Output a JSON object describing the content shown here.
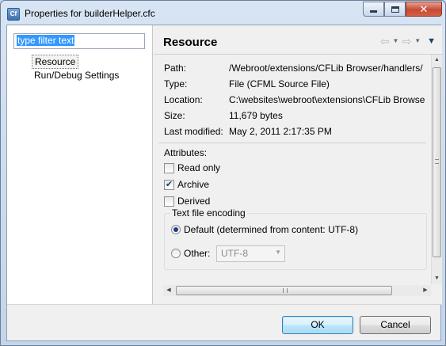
{
  "window": {
    "title": "Properties for builderHelper.cfc",
    "app_icon_text": "Cf",
    "close_glyph": "✕"
  },
  "left": {
    "filter_value": "type filter text",
    "tree_items": [
      {
        "label": "Resource",
        "selected": true
      },
      {
        "label": "Run/Debug Settings",
        "selected": false
      }
    ]
  },
  "right": {
    "title": "Resource",
    "icons": [
      "back-arrow-icon",
      "dropdown-icon",
      "forward-arrow-icon",
      "dropdown-icon",
      "view-menu-icon"
    ],
    "properties": [
      {
        "label": "Path:",
        "value": "/Webroot/extensions/CFLib Browser/handlers/"
      },
      {
        "label": "Type:",
        "value": "File  (CFML Source File)"
      },
      {
        "label": "Location:",
        "value": "C:\\websites\\webroot\\extensions\\CFLib Browse"
      },
      {
        "label": "Size:",
        "value": "11,679  bytes"
      },
      {
        "label": "Last modified:",
        "value": "May 2, 2011 2:17:35 PM"
      }
    ],
    "attributes_title": "Attributes:",
    "attributes": [
      {
        "label": "Read only",
        "checked": false
      },
      {
        "label": "Archive",
        "checked": true
      },
      {
        "label": "Derived",
        "checked": false
      }
    ],
    "encoding": {
      "title": "Text file encoding",
      "default_label": "Default (determined from content: UTF-8)",
      "default_selected": true,
      "other_label": "Other:",
      "other_selected": false,
      "other_value": "UTF-8"
    }
  },
  "buttons": {
    "ok": "OK",
    "cancel": "Cancel"
  },
  "colors": {
    "titlebar": "#c9d9ec",
    "close_button": "#c74a34",
    "selection": "#3399ff"
  }
}
